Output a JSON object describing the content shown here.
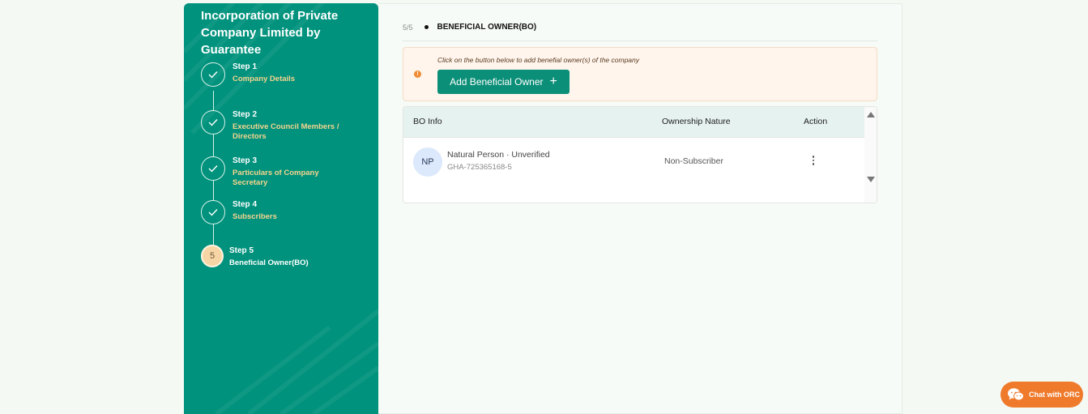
{
  "sidebar": {
    "title": "Incorporation of Private Company Limited by Guarantee",
    "steps": [
      {
        "num": "Step 1",
        "label": "Company Details",
        "status": "completed"
      },
      {
        "num": "Step 2",
        "label": "Executive Council Members / Directors",
        "status": "completed"
      },
      {
        "num": "Step 3",
        "label": "Particulars of Company Secretary",
        "status": "completed"
      },
      {
        "num": "Step 4",
        "label": "Subscribers",
        "status": "completed"
      },
      {
        "num": "Step 5",
        "label": "Beneficial Owner(BO)",
        "status": "active",
        "index": "5"
      }
    ],
    "check_icon": "check-icon"
  },
  "main": {
    "step_fraction": "5/5",
    "section_title": "BENEFICIAL OWNER(BO)",
    "notice": {
      "hint": "Click on the button below to add benefial owner(s) of the company",
      "button_label": "Add Beneficial Owner",
      "button_icon": "+"
    },
    "table": {
      "headers": [
        "BO Info",
        "Ownership Nature",
        "Action"
      ],
      "rows": [
        {
          "avatar": "NP",
          "name": "Natural Person · Unverified",
          "id": "GHA-725365168-5",
          "nature": "Non-Subscriber"
        }
      ]
    }
  },
  "chat": {
    "label": "Chat with ORC"
  },
  "colors": {
    "sidebar": "#00927c",
    "accent_button": "#0c8f78",
    "active_step": "#f8d5a4",
    "chat": "#ef7a2b",
    "warning": "#ef8b33"
  }
}
